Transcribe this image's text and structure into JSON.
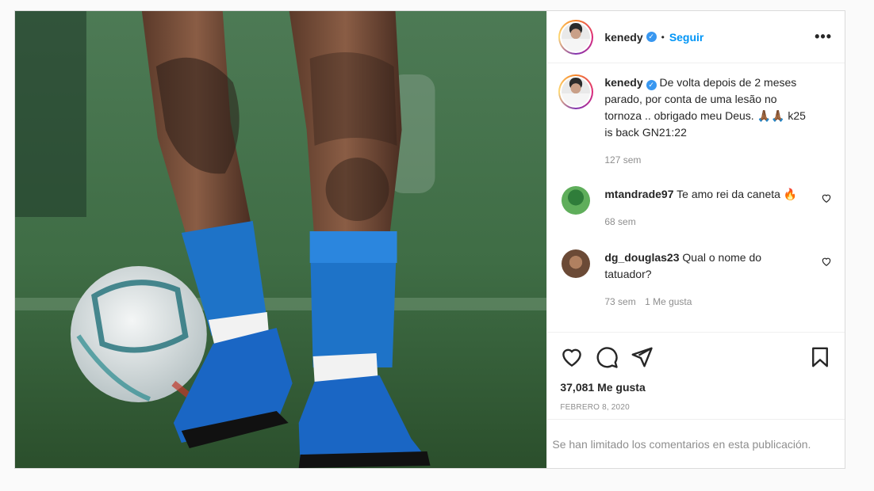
{
  "post": {
    "author": "kenedy",
    "follow_label": "Seguir",
    "separator": "•",
    "more_label": "•••",
    "verified_glyph": "✓"
  },
  "caption": {
    "username": "kenedy",
    "text": "De volta depois de 2 meses parado, por conta de uma lesão no tornoza .. obrigado meu Deus. 🙏🏾🙏🏾 k25 is back GN21:22",
    "time": "127 sem"
  },
  "comments": [
    {
      "username": "mtandrade97",
      "text": "Te amo rei da caneta 🔥",
      "time": "68 sem",
      "likes": ""
    },
    {
      "username": "dg_douglas23",
      "text": "Qual o nome do tatuador?",
      "time": "73 sem",
      "likes": "1 Me gusta"
    }
  ],
  "footer": {
    "likes": "37,081 Me gusta",
    "date": "FEBRERO 8, 2020",
    "limited": "Se han limitado los comentarios en esta publicación."
  },
  "icons": {
    "like": "heart-icon",
    "comment": "comment-icon",
    "share": "share-icon",
    "save": "bookmark-icon"
  },
  "colors": {
    "accent": "#0095f6",
    "verified": "#3897f0",
    "muted": "#8e8e8e",
    "sock": "#1e73c8"
  }
}
